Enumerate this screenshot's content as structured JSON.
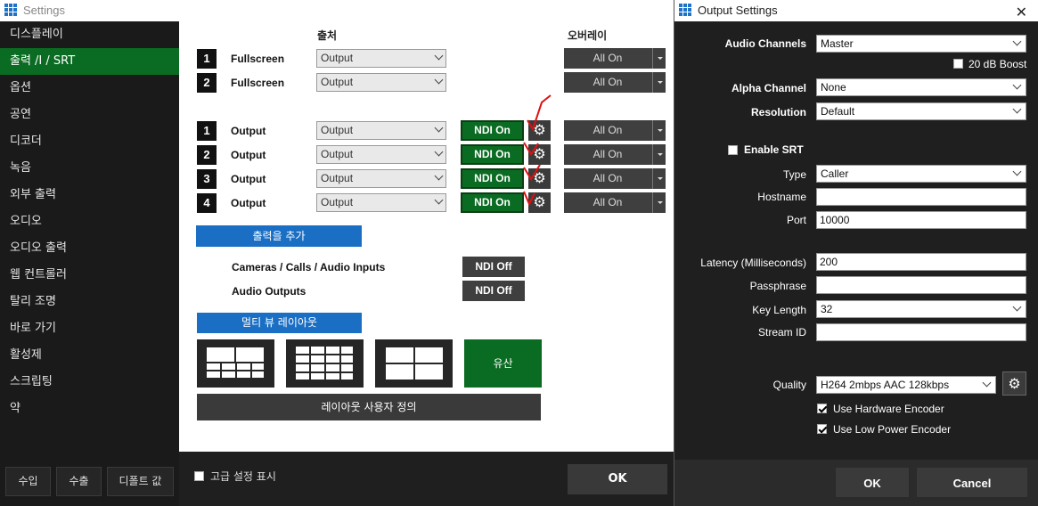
{
  "settings_window": {
    "title": "Settings",
    "sidebar": {
      "items": [
        {
          "label": "디스플레이",
          "active": false
        },
        {
          "label": "출력 /I / SRT",
          "active": true
        },
        {
          "label": "옵션",
          "active": false
        },
        {
          "label": "공연",
          "active": false
        },
        {
          "label": "디코더",
          "active": false
        },
        {
          "label": "녹음",
          "active": false
        },
        {
          "label": "외부 출력",
          "active": false
        },
        {
          "label": "오디오",
          "active": false
        },
        {
          "label": "오디오 출력",
          "active": false
        },
        {
          "label": "웹 컨트롤러",
          "active": false
        },
        {
          "label": "탈리 조명",
          "active": false
        },
        {
          "label": "바로 가기",
          "active": false
        },
        {
          "label": "활성제",
          "active": false
        },
        {
          "label": "스크립팅",
          "active": false
        },
        {
          "label": "약",
          "active": false
        }
      ],
      "buttons": {
        "import": "수입",
        "export": "수출",
        "default": "디폴트 값"
      }
    },
    "headers": {
      "source": "출처",
      "overlay": "오버레이"
    },
    "fullscreen_rows": [
      {
        "num": "1",
        "label": "Fullscreen",
        "source": "Output",
        "overlay": "All On"
      },
      {
        "num": "2",
        "label": "Fullscreen",
        "source": "Output",
        "overlay": "All On"
      }
    ],
    "output_rows": [
      {
        "num": "1",
        "label": "Output",
        "source": "Output",
        "ndi": "NDI On",
        "overlay": "All On"
      },
      {
        "num": "2",
        "label": "Output",
        "source": "Output",
        "ndi": "NDI On",
        "overlay": "All On"
      },
      {
        "num": "3",
        "label": "Output",
        "source": "Output",
        "ndi": "NDI On",
        "overlay": "All On"
      },
      {
        "num": "4",
        "label": "Output",
        "source": "Output",
        "ndi": "NDI On",
        "overlay": "All On"
      }
    ],
    "add_output_label": "출력을 추가",
    "ndi_rows": [
      {
        "label": "Cameras / Calls / Audio Inputs",
        "state": "NDI Off"
      },
      {
        "label": "Audio Outputs",
        "state": "NDI Off"
      }
    ],
    "multiview_layout_label": "멀티 뷰 레이아웃",
    "layout_custom_label": "유산",
    "layout_customize_label": "레이아웃 사용자 정의",
    "advanced_label": "고급 설정 표시",
    "ok_label": "OK"
  },
  "output_settings": {
    "title": "Output Settings",
    "audio_channels": {
      "label": "Audio Channels",
      "value": "Master"
    },
    "boost_label": "20 dB Boost",
    "alpha_channel": {
      "label": "Alpha Channel",
      "value": "None"
    },
    "resolution": {
      "label": "Resolution",
      "value": "Default"
    },
    "enable_srt_label": "Enable SRT",
    "type": {
      "label": "Type",
      "value": "Caller"
    },
    "hostname": {
      "label": "Hostname",
      "value": ""
    },
    "port": {
      "label": "Port",
      "value": "10000"
    },
    "latency": {
      "label": "Latency (Milliseconds)",
      "value": "200"
    },
    "passphrase": {
      "label": "Passphrase",
      "value": ""
    },
    "key_length": {
      "label": "Key Length",
      "value": "32"
    },
    "stream_id": {
      "label": "Stream ID",
      "value": ""
    },
    "quality": {
      "label": "Quality",
      "value": "H264 2mbps AAC 128kbps"
    },
    "hw_encoder_label": "Use Hardware Encoder",
    "low_power_label": "Use Low Power Encoder",
    "ok_label": "OK",
    "cancel_label": "Cancel"
  },
  "colors": {
    "accent_green": "#0a6b22",
    "accent_blue": "#1a6fc4",
    "annotation_red": "#e01010"
  }
}
